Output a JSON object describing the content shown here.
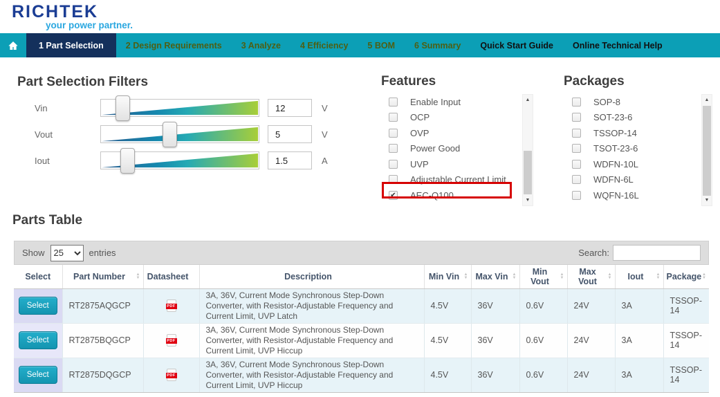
{
  "brand": {
    "name": "RICHTEK",
    "tagline": "your power partner."
  },
  "nav": {
    "items": [
      {
        "label": "1 Part Selection",
        "active": true
      },
      {
        "label": "2 Design Requirements"
      },
      {
        "label": "3 Analyze"
      },
      {
        "label": "4 Efficiency"
      },
      {
        "label": "5 BOM"
      },
      {
        "label": "6 Summary"
      },
      {
        "label": "Quick Start Guide",
        "help": true
      },
      {
        "label": "Online Technical Help",
        "help": true
      }
    ]
  },
  "filters": {
    "title": "Part Selection Filters",
    "sliders": [
      {
        "label": "Vin",
        "value": "12",
        "unit": "V",
        "position_pct": 14
      },
      {
        "label": "Vout",
        "value": "5",
        "unit": "V",
        "position_pct": 44
      },
      {
        "label": "Iout",
        "value": "1.5",
        "unit": "A",
        "position_pct": 17
      }
    ]
  },
  "features": {
    "title": "Features",
    "options": [
      {
        "label": "Enable Input",
        "checked": false
      },
      {
        "label": "OCP",
        "checked": false
      },
      {
        "label": "OVP",
        "checked": false
      },
      {
        "label": "Power Good",
        "checked": false
      },
      {
        "label": "UVP",
        "checked": false
      },
      {
        "label": "Adjustable Current Limit",
        "checked": false
      },
      {
        "label": "AEC-Q100",
        "checked": true,
        "highlighted": true
      }
    ]
  },
  "packages": {
    "title": "Packages",
    "options": [
      {
        "label": "SOP-8",
        "checked": false
      },
      {
        "label": "SOT-23-6",
        "checked": false
      },
      {
        "label": "TSSOP-14",
        "checked": false
      },
      {
        "label": "TSOT-23-6",
        "checked": false
      },
      {
        "label": "WDFN-10L",
        "checked": false
      },
      {
        "label": "WDFN-6L",
        "checked": false
      },
      {
        "label": "WQFN-16L",
        "checked": false
      }
    ]
  },
  "parts_table": {
    "title": "Parts Table",
    "show_label": "Show",
    "entries_value": "25",
    "entries_label": "entries",
    "search_label": "Search:",
    "search_value": "",
    "select_button_label": "Select",
    "pdf_icon_text": "PDF",
    "columns": [
      {
        "label": "Select",
        "sortable": false
      },
      {
        "label": "Part Number",
        "sortable": true
      },
      {
        "label": "Datasheet",
        "sortable": false
      },
      {
        "label": "Description",
        "sortable": false
      },
      {
        "label": "Min Vin",
        "sortable": true
      },
      {
        "label": "Max Vin",
        "sortable": true
      },
      {
        "label": "Min Vout",
        "sortable": true
      },
      {
        "label": "Max Vout",
        "sortable": true
      },
      {
        "label": "Iout",
        "sortable": true
      },
      {
        "label": "Package",
        "sortable": true
      }
    ],
    "rows": [
      {
        "part_number": "RT2875AQGCP",
        "description": "3A, 36V, Current Mode Synchronous Step-Down Converter, with Resistor-Adjustable Frequency and Current Limit, UVP Latch",
        "min_vin": "4.5V",
        "max_vin": "36V",
        "min_vout": "0.6V",
        "max_vout": "24V",
        "iout": "3A",
        "package": "TSSOP-14"
      },
      {
        "part_number": "RT2875BQGCP",
        "description": "3A, 36V, Current Mode Synchronous Step-Down Converter, with Resistor-Adjustable Frequency and Current Limit, UVP Hiccup",
        "min_vin": "4.5V",
        "max_vin": "36V",
        "min_vout": "0.6V",
        "max_vout": "24V",
        "iout": "3A",
        "package": "TSSOP-14"
      },
      {
        "part_number": "RT2875DQGCP",
        "description": "3A, 36V, Current Mode Synchronous Step-Down Converter, with Resistor-Adjustable Frequency and Current Limit, UVP Hiccup",
        "min_vin": "4.5V",
        "max_vin": "36V",
        "min_vout": "0.6V",
        "max_vout": "24V",
        "iout": "3A",
        "package": "TSSOP-14"
      }
    ]
  },
  "icons": {
    "check": "✔",
    "sort_asc": "▲",
    "sort_desc": "▼",
    "scroll_up": "▲",
    "scroll_down": "▼"
  },
  "colors": {
    "nav_teal": "#0C9FB6",
    "active_tab_navy": "#14305C",
    "logo_navy": "#1B3D94",
    "tagline_blue": "#2AA7E0",
    "button_teal": "#1494B0",
    "highlight_red": "#D60000",
    "row_stripe_blue": "#E7F3F8",
    "select_column_lavender": "#DADAF3",
    "slider_gradient": [
      "#2A5D8F",
      "#26AAB4",
      "#A8CE38"
    ]
  }
}
